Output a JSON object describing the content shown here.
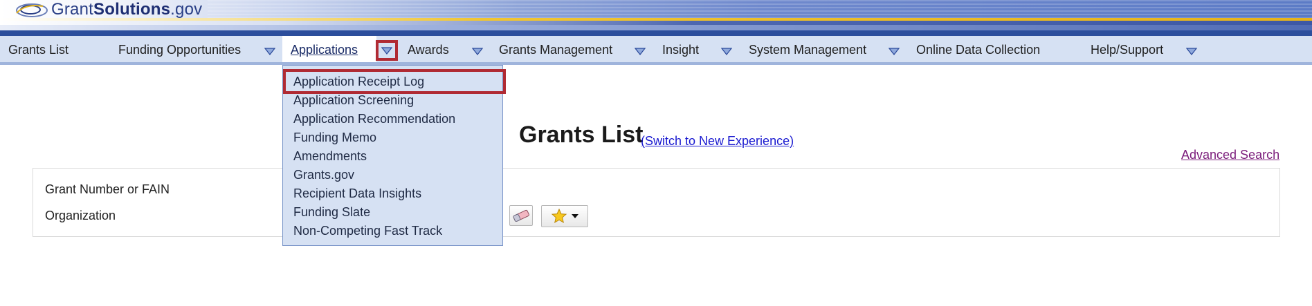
{
  "brand": {
    "logo_prefix": "Grant",
    "logo_bold": "Solutions",
    "logo_suffix": ".gov"
  },
  "nav": {
    "grants_list": "Grants List",
    "funding_opportunities": "Funding Opportunities",
    "applications": "Applications",
    "awards": "Awards",
    "grants_management": "Grants Management",
    "insight": "Insight",
    "system_management": "System Management",
    "online_data_collection": "Online Data Collection",
    "help_support": "Help/Support"
  },
  "applications_menu": {
    "items": [
      "Application Receipt Log",
      "Application Screening",
      "Application Recommendation",
      "Funding Memo",
      "Amendments",
      "Grants.gov",
      "Recipient Data Insights",
      "Funding Slate",
      "Non-Competing Fast Track"
    ],
    "highlighted": "Application Receipt Log"
  },
  "page": {
    "title": "Grants List",
    "switch_link": "(Switch to New Experience)",
    "advanced_search": "Advanced Search"
  },
  "search_form": {
    "grant_number_label": "Grant Number or FAIN",
    "organization_label": "Organization"
  },
  "icons": {
    "eraser": "eraser-icon",
    "favorites": "star-icon",
    "nav_dropdown": "triangle-down-icon"
  },
  "colors": {
    "nav_background": "#d6e1f3",
    "highlight_border": "#b02a33",
    "link": "#1a1ad0",
    "visited_link": "#7a1a7a"
  }
}
